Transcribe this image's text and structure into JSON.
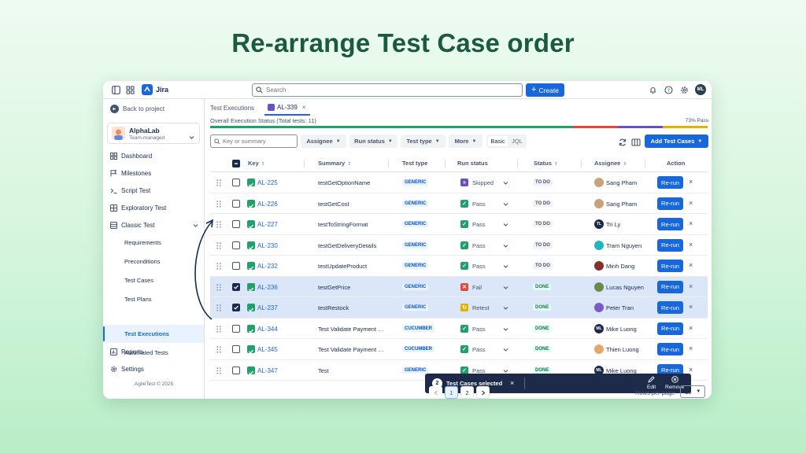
{
  "hero_title": "Re-arrange Test Case order",
  "topbar": {
    "app_name": "Jira",
    "search_placeholder": "Search",
    "create_label": "Create",
    "user_initials": "ML"
  },
  "sidebar": {
    "back_label": "Back to project",
    "project_name": "AlphaLab",
    "project_type": "Team-managed",
    "items": [
      {
        "label": "Dashboard",
        "icon": "dashboard-icon"
      },
      {
        "label": "Milestones",
        "icon": "flag-icon"
      },
      {
        "label": "Script Test",
        "icon": "script-icon"
      },
      {
        "label": "Exploratory Test",
        "icon": "grid-icon"
      },
      {
        "label": "Classic Test",
        "icon": "list-icon"
      }
    ],
    "sub_items": [
      "Requirements",
      "Preconditions",
      "Test Cases",
      "Test Plans",
      "Test Executions",
      "Automated Tests"
    ],
    "active_sub_item": "Test Executions",
    "bottom_items": [
      {
        "label": "Reports",
        "icon": "reports-icon"
      },
      {
        "label": "Settings",
        "icon": "gear-icon"
      }
    ],
    "footer": "AgileTest © 2025"
  },
  "tabs": {
    "first": "Test Executions",
    "active": "AL-339"
  },
  "overall_status": "Overall Execution Status (Total tests: 11)",
  "pass_percent": "73% Pass",
  "progress": {
    "pass": 0.73,
    "fail": 0.09,
    "skipped": 0.09,
    "retest": 0.09,
    "colors": {
      "pass": "#22a06b",
      "fail": "#e2483d",
      "skipped": "#6554c0",
      "retest": "#e2b203"
    }
  },
  "toolbar": {
    "search_placeholder": "Key or summary",
    "filters": [
      "Assignee",
      "Run status",
      "Test type",
      "More"
    ],
    "seg_basic": "Basic",
    "seg_jql": "JQL",
    "add_label": "Add Test Cases"
  },
  "table": {
    "headers": {
      "key": "Key",
      "summary": "Summary",
      "type": "Test type",
      "run": "Run status",
      "status": "Status",
      "assignee": "Assignee",
      "action": "Action"
    },
    "rerun_label": "Re-run",
    "rows": [
      {
        "key": "AL-225",
        "summary": "testGetOptionName",
        "type": "GENERIC",
        "run": "Skipped",
        "status": "TO DO",
        "assignee": "Sang Pham",
        "initials": "",
        "selected": false
      },
      {
        "key": "AL-226",
        "summary": "testGetCost",
        "type": "GENERIC",
        "run": "Pass",
        "status": "TO DO",
        "assignee": "Sang Pham",
        "initials": "",
        "selected": false
      },
      {
        "key": "AL-227",
        "summary": "testToStringFormat",
        "type": "GENERIC",
        "run": "Pass",
        "status": "TO DO",
        "assignee": "Tri Ly",
        "initials": "TL",
        "selected": false
      },
      {
        "key": "AL-230",
        "summary": "testGetDeliveryDetails",
        "type": "GENERIC",
        "run": "Pass",
        "status": "TO DO",
        "assignee": "Tram Nguyen",
        "initials": "",
        "selected": false
      },
      {
        "key": "AL-232",
        "summary": "testUpdateProduct",
        "type": "GENERIC",
        "run": "Pass",
        "status": "TO DO",
        "assignee": "Minh Dang",
        "initials": "",
        "selected": false
      },
      {
        "key": "AL-236",
        "summary": "testGetPrice",
        "type": "GENERIC",
        "run": "Fail",
        "status": "DONE",
        "assignee": "Lucas Nguyen",
        "initials": "",
        "selected": true
      },
      {
        "key": "AL-237",
        "summary": "testRestock",
        "type": "GENERIC",
        "run": "Retest",
        "status": "DONE",
        "assignee": "Peter Tran",
        "initials": "",
        "selected": true
      },
      {
        "key": "AL-344",
        "summary": "Test Validate Payment Methods",
        "type": "CUCUMBER",
        "run": "Pass",
        "status": "DONE",
        "assignee": "Mike Luong",
        "initials": "ML",
        "selected": false
      },
      {
        "key": "AL-345",
        "summary": "Test Validate Payment Flow",
        "type": "CUCUMBER",
        "run": "Pass",
        "status": "DONE",
        "assignee": "Thien Luong",
        "initials": "",
        "selected": false
      },
      {
        "key": "AL-347",
        "summary": "Test",
        "type": "GENERIC",
        "run": "Pass",
        "status": "DONE",
        "assignee": "Mike Luong",
        "initials": "ML",
        "selected": false
      }
    ]
  },
  "selection_bar": {
    "count": "2",
    "label": "Test Cases selected",
    "edit_label": "Edit",
    "remove_label": "Remove"
  },
  "pagination": {
    "pages": [
      "1",
      "2"
    ],
    "current": "1",
    "rows_label": "Rows per page",
    "rows_value": "10"
  }
}
